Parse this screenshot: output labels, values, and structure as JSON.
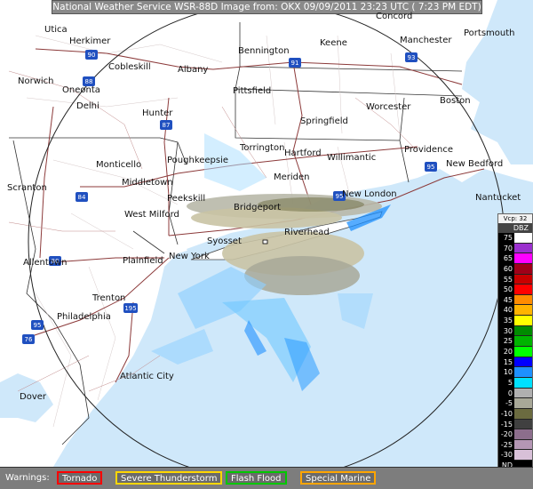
{
  "header": {
    "title": "National Weather Service WSR-88D Image from: OKX 09/09/2011  23:23 UTC  ( 7:23 PM EDT)"
  },
  "cities": [
    "Utica",
    "Herkimer",
    "Cobleskill",
    "Albany",
    "Bennington",
    "Keene",
    "Concord",
    "Manchester",
    "Portsmouth",
    "Norwich",
    "Oneonta",
    "Delhi",
    "Pittsfield",
    "Hunter",
    "Springfield",
    "Worcester",
    "Boston",
    "Monticello",
    "Poughkeepsie",
    "Torrington",
    "Hartford",
    "Willimantic",
    "Providence",
    "New Bedford",
    "Scranton",
    "Middletown",
    "Meriden",
    "New London",
    "Nantucket",
    "West Milford",
    "Peekskill",
    "Bridgeport",
    "Riverhead",
    "Syosset",
    "Allentown",
    "Plainfield",
    "New York",
    "Trenton",
    "Philadelphia",
    "Atlantic City",
    "Dover"
  ],
  "highways": [
    "90",
    "88",
    "91",
    "93",
    "87",
    "95",
    "84",
    "80",
    "195",
    "95",
    "76",
    "95"
  ],
  "legend": {
    "mode": "Vcp: 32",
    "unit": "DBZ",
    "levels": [
      {
        "value": "75",
        "color": "#ffffff"
      },
      {
        "value": "70",
        "color": "#9b30ce"
      },
      {
        "value": "65",
        "color": "#ff00ff"
      },
      {
        "value": "60",
        "color": "#a00018"
      },
      {
        "value": "55",
        "color": "#c80000"
      },
      {
        "value": "50",
        "color": "#ff0000"
      },
      {
        "value": "45",
        "color": "#ff8c00"
      },
      {
        "value": "40",
        "color": "#ffb400"
      },
      {
        "value": "35",
        "color": "#ffff00"
      },
      {
        "value": "30",
        "color": "#008c00"
      },
      {
        "value": "25",
        "color": "#00b400"
      },
      {
        "value": "20",
        "color": "#00ff00"
      },
      {
        "value": "15",
        "color": "#0000ff"
      },
      {
        "value": "10",
        "color": "#1e90ff"
      },
      {
        "value": "5",
        "color": "#00e0ff"
      },
      {
        "value": "0",
        "color": "#b0b0b0"
      },
      {
        "value": "-5",
        "color": "#a8a898"
      },
      {
        "value": "-10",
        "color": "#6b6b40"
      },
      {
        "value": "-15",
        "color": "#404040"
      },
      {
        "value": "-20",
        "color": "#8c6e8c"
      },
      {
        "value": "-25",
        "color": "#b496b4"
      },
      {
        "value": "-30",
        "color": "#d8c0d8"
      },
      {
        "value": "ND",
        "color": "#000000"
      }
    ]
  },
  "warnings": {
    "label": "Warnings:",
    "items": [
      {
        "name": "Tornado",
        "color": "#ff0000"
      },
      {
        "name": "Severe Thunderstorm",
        "color": "#ffd700"
      },
      {
        "name": "Flash Flood",
        "color": "#00c800"
      },
      {
        "name": "Special Marine",
        "color": "#ffa500"
      }
    ]
  }
}
